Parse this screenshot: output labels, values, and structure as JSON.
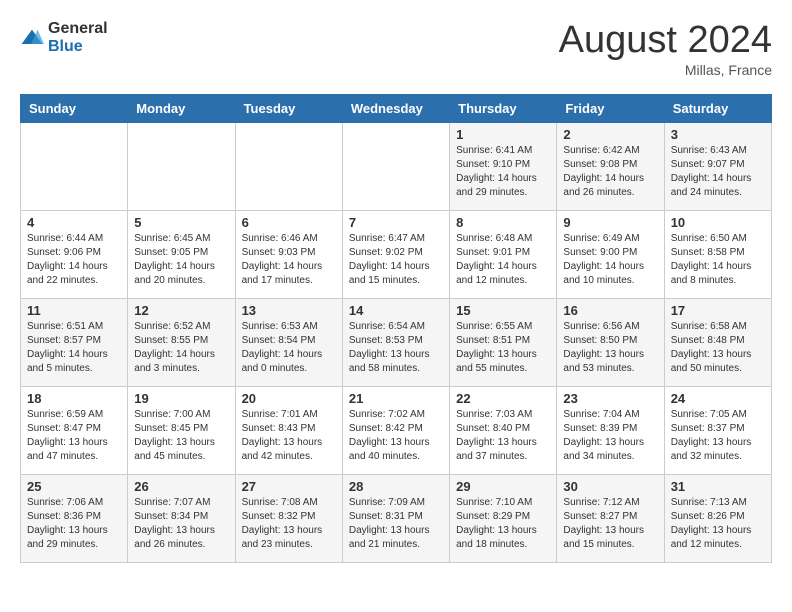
{
  "logo": {
    "general": "General",
    "blue": "Blue"
  },
  "header": {
    "month_year": "August 2024",
    "location": "Millas, France"
  },
  "weekdays": [
    "Sunday",
    "Monday",
    "Tuesday",
    "Wednesday",
    "Thursday",
    "Friday",
    "Saturday"
  ],
  "weeks": [
    [
      {
        "day": "",
        "info": ""
      },
      {
        "day": "",
        "info": ""
      },
      {
        "day": "",
        "info": ""
      },
      {
        "day": "",
        "info": ""
      },
      {
        "day": "1",
        "info": "Sunrise: 6:41 AM\nSunset: 9:10 PM\nDaylight: 14 hours\nand 29 minutes."
      },
      {
        "day": "2",
        "info": "Sunrise: 6:42 AM\nSunset: 9:08 PM\nDaylight: 14 hours\nand 26 minutes."
      },
      {
        "day": "3",
        "info": "Sunrise: 6:43 AM\nSunset: 9:07 PM\nDaylight: 14 hours\nand 24 minutes."
      }
    ],
    [
      {
        "day": "4",
        "info": "Sunrise: 6:44 AM\nSunset: 9:06 PM\nDaylight: 14 hours\nand 22 minutes."
      },
      {
        "day": "5",
        "info": "Sunrise: 6:45 AM\nSunset: 9:05 PM\nDaylight: 14 hours\nand 20 minutes."
      },
      {
        "day": "6",
        "info": "Sunrise: 6:46 AM\nSunset: 9:03 PM\nDaylight: 14 hours\nand 17 minutes."
      },
      {
        "day": "7",
        "info": "Sunrise: 6:47 AM\nSunset: 9:02 PM\nDaylight: 14 hours\nand 15 minutes."
      },
      {
        "day": "8",
        "info": "Sunrise: 6:48 AM\nSunset: 9:01 PM\nDaylight: 14 hours\nand 12 minutes."
      },
      {
        "day": "9",
        "info": "Sunrise: 6:49 AM\nSunset: 9:00 PM\nDaylight: 14 hours\nand 10 minutes."
      },
      {
        "day": "10",
        "info": "Sunrise: 6:50 AM\nSunset: 8:58 PM\nDaylight: 14 hours\nand 8 minutes."
      }
    ],
    [
      {
        "day": "11",
        "info": "Sunrise: 6:51 AM\nSunset: 8:57 PM\nDaylight: 14 hours\nand 5 minutes."
      },
      {
        "day": "12",
        "info": "Sunrise: 6:52 AM\nSunset: 8:55 PM\nDaylight: 14 hours\nand 3 minutes."
      },
      {
        "day": "13",
        "info": "Sunrise: 6:53 AM\nSunset: 8:54 PM\nDaylight: 14 hours\nand 0 minutes."
      },
      {
        "day": "14",
        "info": "Sunrise: 6:54 AM\nSunset: 8:53 PM\nDaylight: 13 hours\nand 58 minutes."
      },
      {
        "day": "15",
        "info": "Sunrise: 6:55 AM\nSunset: 8:51 PM\nDaylight: 13 hours\nand 55 minutes."
      },
      {
        "day": "16",
        "info": "Sunrise: 6:56 AM\nSunset: 8:50 PM\nDaylight: 13 hours\nand 53 minutes."
      },
      {
        "day": "17",
        "info": "Sunrise: 6:58 AM\nSunset: 8:48 PM\nDaylight: 13 hours\nand 50 minutes."
      }
    ],
    [
      {
        "day": "18",
        "info": "Sunrise: 6:59 AM\nSunset: 8:47 PM\nDaylight: 13 hours\nand 47 minutes."
      },
      {
        "day": "19",
        "info": "Sunrise: 7:00 AM\nSunset: 8:45 PM\nDaylight: 13 hours\nand 45 minutes."
      },
      {
        "day": "20",
        "info": "Sunrise: 7:01 AM\nSunset: 8:43 PM\nDaylight: 13 hours\nand 42 minutes."
      },
      {
        "day": "21",
        "info": "Sunrise: 7:02 AM\nSunset: 8:42 PM\nDaylight: 13 hours\nand 40 minutes."
      },
      {
        "day": "22",
        "info": "Sunrise: 7:03 AM\nSunset: 8:40 PM\nDaylight: 13 hours\nand 37 minutes."
      },
      {
        "day": "23",
        "info": "Sunrise: 7:04 AM\nSunset: 8:39 PM\nDaylight: 13 hours\nand 34 minutes."
      },
      {
        "day": "24",
        "info": "Sunrise: 7:05 AM\nSunset: 8:37 PM\nDaylight: 13 hours\nand 32 minutes."
      }
    ],
    [
      {
        "day": "25",
        "info": "Sunrise: 7:06 AM\nSunset: 8:36 PM\nDaylight: 13 hours\nand 29 minutes."
      },
      {
        "day": "26",
        "info": "Sunrise: 7:07 AM\nSunset: 8:34 PM\nDaylight: 13 hours\nand 26 minutes."
      },
      {
        "day": "27",
        "info": "Sunrise: 7:08 AM\nSunset: 8:32 PM\nDaylight: 13 hours\nand 23 minutes."
      },
      {
        "day": "28",
        "info": "Sunrise: 7:09 AM\nSunset: 8:31 PM\nDaylight: 13 hours\nand 21 minutes."
      },
      {
        "day": "29",
        "info": "Sunrise: 7:10 AM\nSunset: 8:29 PM\nDaylight: 13 hours\nand 18 minutes."
      },
      {
        "day": "30",
        "info": "Sunrise: 7:12 AM\nSunset: 8:27 PM\nDaylight: 13 hours\nand 15 minutes."
      },
      {
        "day": "31",
        "info": "Sunrise: 7:13 AM\nSunset: 8:26 PM\nDaylight: 13 hours\nand 12 minutes."
      }
    ]
  ]
}
